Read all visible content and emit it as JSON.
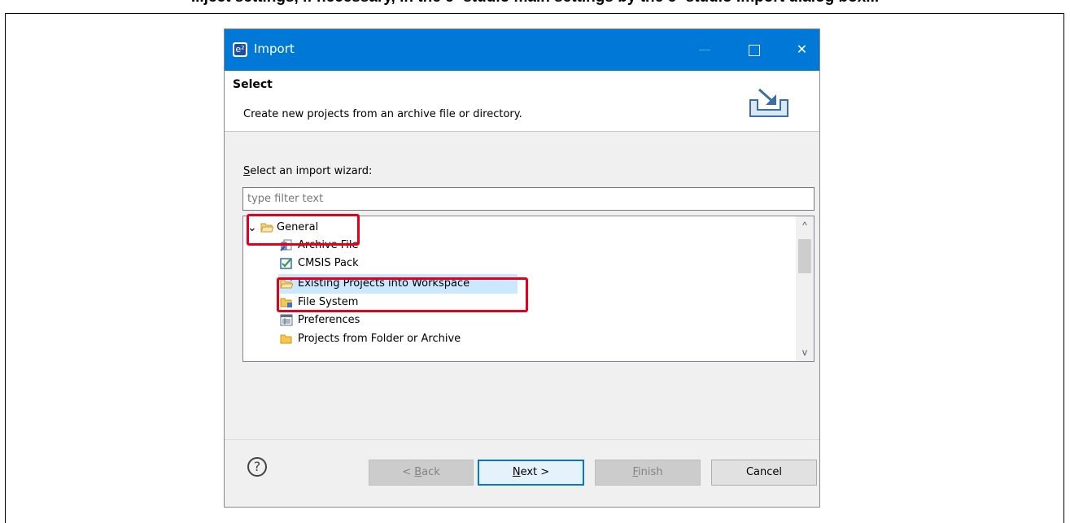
{
  "clipped_heading": "...ject settings, if necessary, in the e² studio main settings by the e² studio Import dialog box...",
  "window": {
    "app_icon_glyph": "e²",
    "title": "Import",
    "minimize_label": "",
    "maximize_label": "",
    "close_label": "✕"
  },
  "header": {
    "title": "Select",
    "description": "Create new projects from an archive file or directory."
  },
  "wizard": {
    "label_first": "S",
    "label_rest": "elect an import wizard:",
    "filter_placeholder": "type filter text",
    "tree": [
      {
        "label": "General",
        "icon": "open-folder-icon",
        "expander": "⌄"
      },
      {
        "label": "Archive File",
        "icon": "archive-file-icon"
      },
      {
        "label": "CMSIS Pack",
        "icon": "cmsis-pack-icon"
      },
      {
        "label": "Existing Projects into Workspace",
        "icon": "existing-projects-icon",
        "selected": true
      },
      {
        "label": "File System",
        "icon": "file-system-folder-icon"
      },
      {
        "label": "Preferences",
        "icon": "preferences-icon"
      },
      {
        "label": "Projects from Folder or Archive",
        "icon": "folder-icon"
      }
    ],
    "scroll_up": "^",
    "scroll_down": "v"
  },
  "buttons": {
    "help": "?",
    "back_prefix": "< ",
    "back_key": "B",
    "back_rest": "ack",
    "next_key": "N",
    "next_rest": "ext >",
    "finish_key": "F",
    "finish_rest": "inish",
    "cancel": "Cancel"
  },
  "colors": {
    "titlebar": "#0078d7",
    "highlight": "#e3001b",
    "selection": "#cce8ff"
  }
}
